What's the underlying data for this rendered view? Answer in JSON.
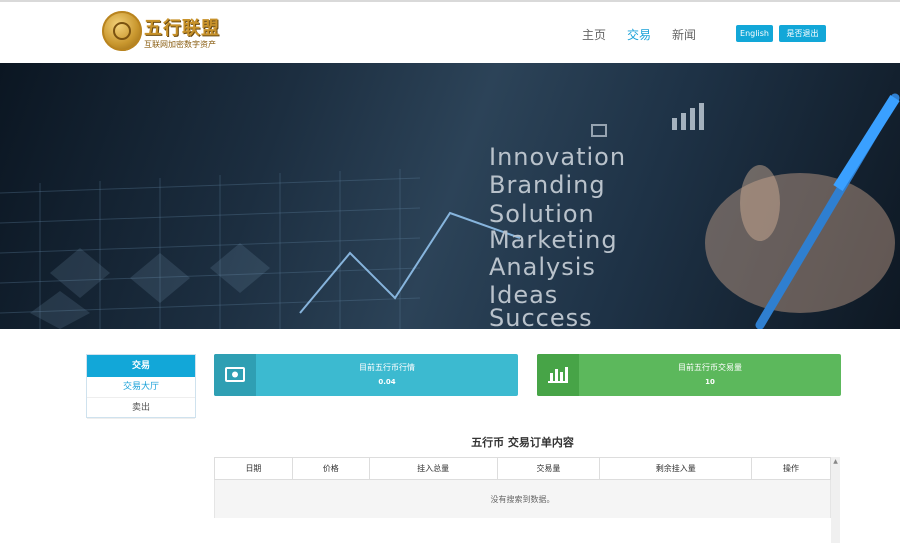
{
  "header": {
    "logo_title": "五行联盟",
    "logo_subtitle": "互联网加密数字资产",
    "nav": [
      "主页",
      "交易",
      "新闻"
    ],
    "nav_active": "交易",
    "english_button": "English",
    "logout_button": "是否退出"
  },
  "banner": {
    "words": [
      "Innovation",
      "Branding",
      "Solution",
      "Marketing",
      "Analysis",
      "Ideas",
      "Success"
    ]
  },
  "sidebar": {
    "title": "交易",
    "items": [
      "交易大厅",
      "卖出"
    ],
    "active_item": "交易大厅"
  },
  "cards": [
    {
      "label": "目前五行币行情",
      "value": "0.04",
      "icon": "money-icon",
      "color": "#3cbad0"
    },
    {
      "label": "目前五行币交易量",
      "value": "10",
      "icon": "bar-chart-icon",
      "color": "#5cb85c"
    }
  ],
  "orders": {
    "title": "五行币  交易订单内容",
    "columns": [
      "日期",
      "价格",
      "挂入总量",
      "交易量",
      "剩余挂入量",
      "操作"
    ],
    "empty_message": "没有搜索到数据。"
  },
  "colors": {
    "accent": "#12a7d8",
    "teal_card": "#3cbad0",
    "green_card": "#5cb85c",
    "gold": "#c8922a"
  }
}
